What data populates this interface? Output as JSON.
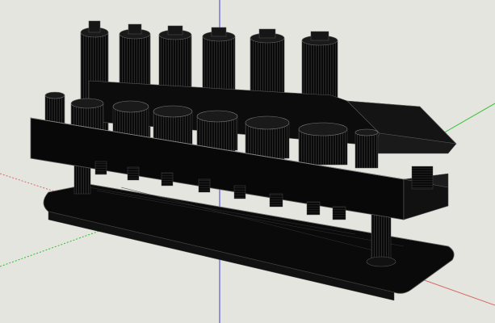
{
  "viewport": {
    "background": "#e5e5e0",
    "axis_colors": {
      "red": "#d86a6a",
      "green": "#2fbf2f",
      "blue": "#3a3ad8"
    }
  },
  "model": {
    "fill": "#0b0b0b",
    "edge": "#5a5a5a",
    "tall_cylinders": 6,
    "sockets": 6
  }
}
